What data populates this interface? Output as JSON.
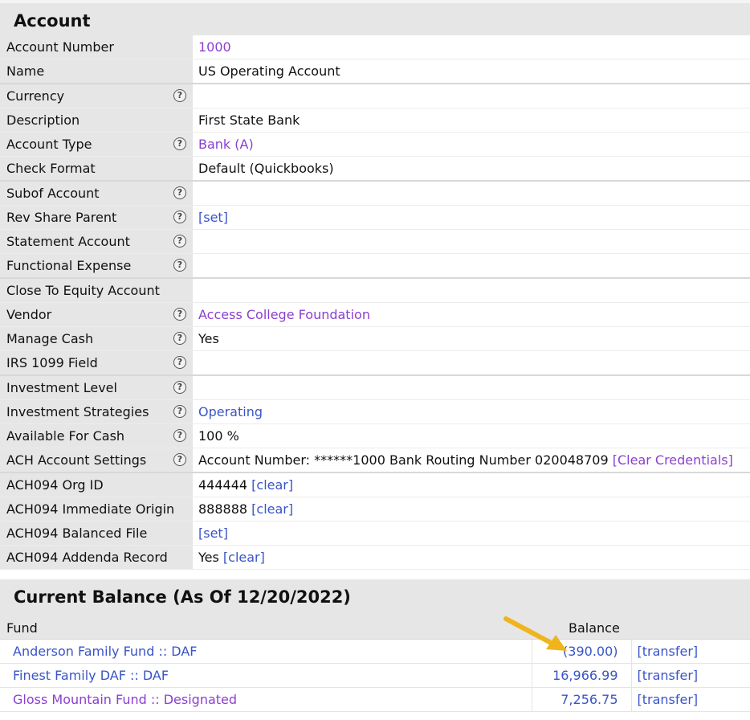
{
  "account": {
    "title": "Account",
    "rows": [
      {
        "label": "Account Number",
        "value": "1000"
      },
      {
        "label": "Name",
        "value": "US Operating Account"
      },
      {
        "label": "Currency",
        "value": ""
      },
      {
        "label": "Description",
        "value": "First State Bank"
      },
      {
        "label": "Account Type",
        "value": "Bank (A)"
      },
      {
        "label": "Check Format",
        "value": "Default (Quickbooks)"
      },
      {
        "label": "Subof Account",
        "value": ""
      },
      {
        "label": "Rev Share Parent",
        "value": "[set]"
      },
      {
        "label": "Statement Account",
        "value": ""
      },
      {
        "label": "Functional Expense",
        "value": ""
      },
      {
        "label": "Close To Equity Account",
        "value": ""
      },
      {
        "label": "Vendor",
        "value": "Access College Foundation"
      },
      {
        "label": "Manage Cash",
        "value": "Yes"
      },
      {
        "label": "IRS 1099 Field",
        "value": ""
      },
      {
        "label": "Investment Level",
        "value": ""
      },
      {
        "label": "Investment Strategies",
        "value": "Operating"
      },
      {
        "label": "Available For Cash",
        "value": "100 %"
      },
      {
        "label": "ACH Account Settings",
        "value": "Account Number: ******1000 Bank Routing Number 020048709",
        "link": "[Clear Credentials]"
      },
      {
        "label": "ACH094 Org ID",
        "value": "444444",
        "link": "[clear]"
      },
      {
        "label": "ACH094 Immediate Origin",
        "value": "888888",
        "link": "[clear]"
      },
      {
        "label": "ACH094 Balanced File",
        "value": "[set]"
      },
      {
        "label": "ACH094 Addenda Record",
        "value": "Yes",
        "link": "[clear]"
      }
    ],
    "help_glyph": "?"
  },
  "balance": {
    "title": "Current Balance (As Of 12/20/2022)",
    "col_fund": "Fund",
    "col_balance": "Balance",
    "rows": [
      {
        "fund": "Anderson Family Fund :: DAF",
        "amount": "(390.00)",
        "action": "[transfer]"
      },
      {
        "fund": "Finest Family DAF :: DAF",
        "amount": "16,966.99",
        "action": "[transfer]"
      },
      {
        "fund": "Gloss Mountain Fund :: Designated",
        "amount": "7,256.75",
        "action": "[transfer]"
      }
    ]
  },
  "colors": {
    "link_blue": "#3a55c7",
    "link_purple": "#8a3fd1",
    "arrow": "#f0b41c"
  }
}
